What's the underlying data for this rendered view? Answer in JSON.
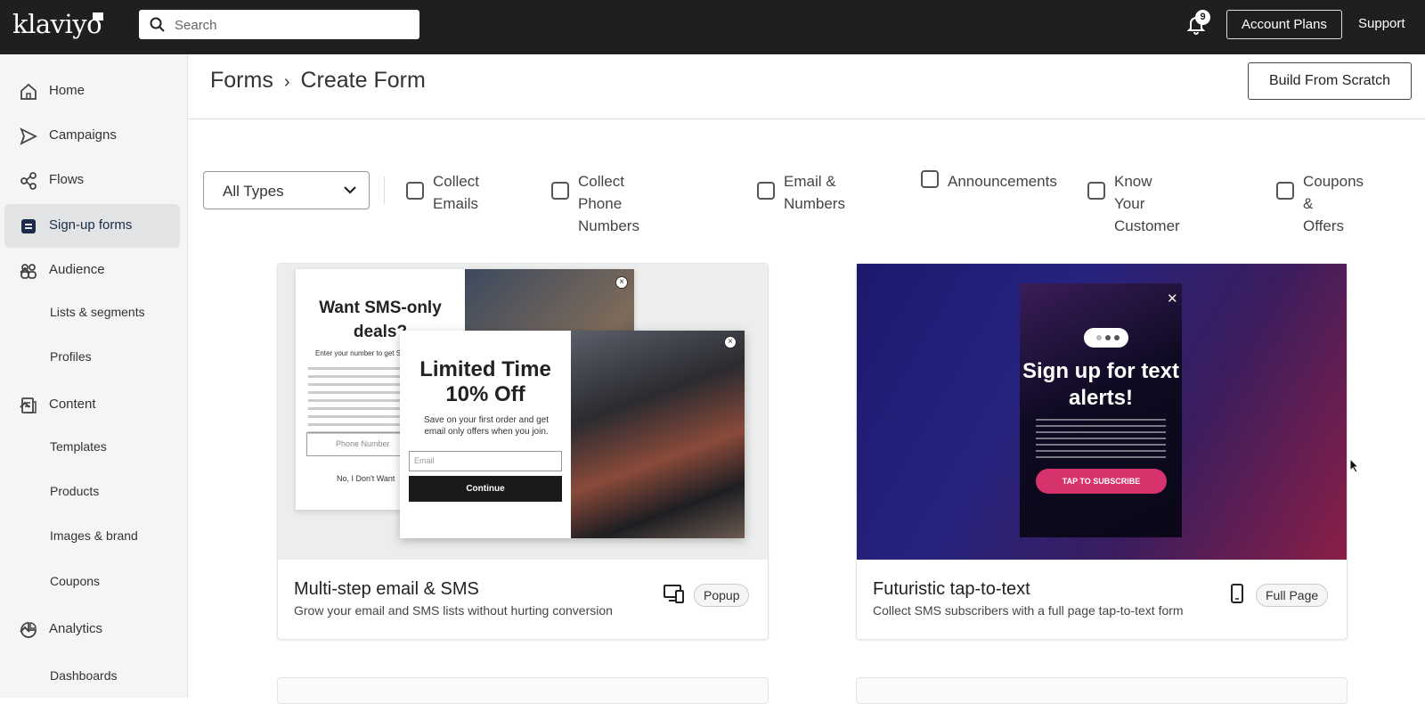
{
  "topbar": {
    "logo": "klaviyo",
    "search_placeholder": "Search",
    "notification_count": "9",
    "account_plans": "Account Plans",
    "support": "Support"
  },
  "sidebar": {
    "items": [
      {
        "label": "Home",
        "icon": "home-icon"
      },
      {
        "label": "Campaigns",
        "icon": "send-icon"
      },
      {
        "label": "Flows",
        "icon": "flow-icon"
      },
      {
        "label": "Sign-up forms",
        "icon": "form-icon"
      },
      {
        "label": "Audience",
        "icon": "audience-icon"
      },
      {
        "label": "Content",
        "icon": "content-icon"
      },
      {
        "label": "Analytics",
        "icon": "analytics-icon"
      }
    ],
    "sub": {
      "lists": "Lists & segments",
      "profiles": "Profiles",
      "templates": "Templates",
      "products": "Products",
      "images": "Images & brand",
      "coupons": "Coupons",
      "dashboards": "Dashboards"
    },
    "active": "Sign-up forms"
  },
  "header": {
    "breadcrumb_root": "Forms",
    "breadcrumb_sep": "›",
    "breadcrumb_current": "Create Form",
    "build_from_scratch": "Build From Scratch"
  },
  "filters": {
    "type_select": "All Types",
    "options": [
      "Collect\nEmails",
      "Collect Phone\nNumbers",
      "Email &\nNumbers",
      "Announcements",
      "Know Your\nCustomer",
      "Coupons &\nOffers"
    ]
  },
  "cards": [
    {
      "title": "Multi-step email & SMS",
      "description": "Grow your email and SMS lists without hurting conversion",
      "tag": "Popup",
      "device_icon": "desktop-mobile-icon",
      "preview": {
        "back_heading": "Want SMS-only deals?",
        "back_sub": "Enter your number to get S",
        "back_phone_placeholder": "Phone Number",
        "back_decline": "No, I Don't Want",
        "front_heading": "Limited Time 10% Off",
        "front_sub": "Save on your first order and get email only offers when you join.",
        "front_email_placeholder": "Email",
        "front_button": "Continue"
      }
    },
    {
      "title": "Futuristic tap-to-text",
      "description": "Collect SMS subscribers with a full page tap-to-text form",
      "tag": "Full Page",
      "device_icon": "mobile-icon",
      "preview": {
        "heading": "Sign up for text alerts!",
        "button": "TAP TO SUBSCRIBE"
      }
    }
  ],
  "colors": {
    "topbar": "#1f1f1f",
    "sidebar": "#f5f5f5",
    "active_nav": "#e1e3e4",
    "tap_button": "#d6336c"
  }
}
